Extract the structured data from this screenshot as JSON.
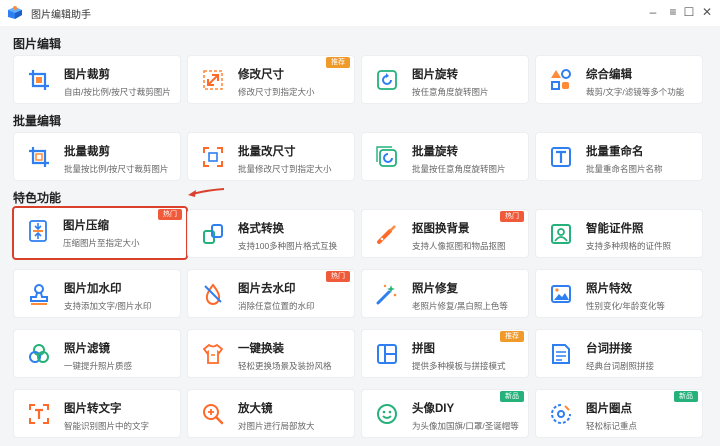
{
  "app": {
    "title": "图片编辑助手"
  },
  "window": {
    "minimize": "–",
    "maximize": "☐",
    "close": "✕"
  },
  "sections": [
    {
      "title": "图片编辑"
    },
    {
      "title": "批量编辑"
    },
    {
      "title": "特色功能"
    }
  ],
  "cards": [
    {
      "name": "图片裁剪",
      "desc": "自由/按比例/按尺寸裁剪图片",
      "icon": "crop-icon"
    },
    {
      "name": "修改尺寸",
      "desc": "修改尺寸到指定大小",
      "icon": "resize-icon",
      "badge": "推荐"
    },
    {
      "name": "图片旋转",
      "desc": "按任意角度旋转图片",
      "icon": "rotate-icon"
    },
    {
      "name": "综合编辑",
      "desc": "裁剪/文字/滤镜等多个功能",
      "icon": "shapes-icon"
    },
    {
      "name": "批量裁剪",
      "desc": "批量按比例/按尺寸裁剪图片",
      "icon": "batch-crop-icon"
    },
    {
      "name": "批量改尺寸",
      "desc": "批量修改尺寸到指定大小",
      "icon": "batch-resize-icon"
    },
    {
      "name": "批量旋转",
      "desc": "批量按任意角度旋转图片",
      "icon": "batch-rotate-icon"
    },
    {
      "name": "批量重命名",
      "desc": "批量重命名图片名称",
      "icon": "rename-icon"
    },
    {
      "name": "图片压缩",
      "desc": "压缩图片至指定大小",
      "icon": "compress-icon",
      "badge": "热门"
    },
    {
      "name": "格式转换",
      "desc": "支持100多种图片格式互换",
      "icon": "convert-icon"
    },
    {
      "name": "抠图换背景",
      "desc": "支持人像抠图和物品抠图",
      "icon": "cutout-icon",
      "badge": "热门"
    },
    {
      "name": "智能证件照",
      "desc": "支持多种规格的证件照",
      "icon": "id-photo-icon"
    },
    {
      "name": "图片加水印",
      "desc": "支持添加文字/图片水印",
      "icon": "stamp-icon"
    },
    {
      "name": "图片去水印",
      "desc": "消除任意位置的水印",
      "icon": "remove-watermark-icon",
      "badge": "热门"
    },
    {
      "name": "照片修复",
      "desc": "老照片修复/黑白照上色等",
      "icon": "magic-wand-icon"
    },
    {
      "name": "照片特效",
      "desc": "性别变化/年龄变化等",
      "icon": "landscape-icon"
    },
    {
      "name": "照片滤镜",
      "desc": "一键提升照片质感",
      "icon": "filter-icon"
    },
    {
      "name": "一键换装",
      "desc": "轻松更换场景及装扮风格",
      "icon": "shirt-icon"
    },
    {
      "name": "拼图",
      "desc": "提供多种模板与拼接模式",
      "icon": "collage-icon",
      "badge": "推荐"
    },
    {
      "name": "台词拼接",
      "desc": "经典台词剧照拼接",
      "icon": "subtitle-icon"
    },
    {
      "name": "图片转文字",
      "desc": "智能识别图片中的文字",
      "icon": "ocr-icon"
    },
    {
      "name": "放大镜",
      "desc": "对图片进行局部放大",
      "icon": "magnifier-icon"
    },
    {
      "name": "头像DIY",
      "desc": "为头像加国旗/口罩/圣诞帽等",
      "icon": "smiley-icon",
      "badge": "新品"
    },
    {
      "name": "图片圈点",
      "desc": "轻松标记重点",
      "icon": "annotate-icon",
      "badge": "新品"
    }
  ],
  "colors": {
    "accent_blue": "#2f7ff0",
    "accent_orange": "#f07a3a",
    "highlight_red": "#d9412d",
    "hot": "#ee5a3a",
    "recommend": "#f09a2a",
    "new": "#24b17a"
  }
}
